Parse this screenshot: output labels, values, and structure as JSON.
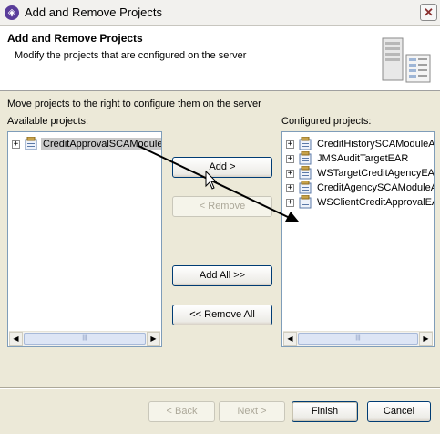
{
  "window": {
    "title": "Add and Remove Projects",
    "close_glyph": "✕",
    "app_icon": "eclipse-icon"
  },
  "banner": {
    "title": "Add and Remove Projects",
    "subtitle": "Modify the projects that are configured on the server",
    "graphic": "server-icon"
  },
  "instruction": "Move projects to the right to configure them on the server",
  "available": {
    "label": "Available projects:",
    "items": [
      {
        "label": "CreditApprovalSCAModule",
        "selected": true,
        "icon": "project-icon"
      }
    ]
  },
  "configured": {
    "label": "Configured projects:",
    "items": [
      {
        "label": "CreditHistorySCAModuleAp",
        "icon": "project-icon"
      },
      {
        "label": "JMSAuditTargetEAR",
        "icon": "project-icon"
      },
      {
        "label": "WSTargetCreditAgencyEAR",
        "icon": "project-icon"
      },
      {
        "label": "CreditAgencySCAModuleAp",
        "icon": "project-icon"
      },
      {
        "label": "WSClientCreditApprovalEA",
        "icon": "project-icon"
      }
    ]
  },
  "buttons": {
    "add": "Add >",
    "remove": "< Remove",
    "add_all": "Add All >>",
    "remove_all": "<< Remove All",
    "back": "< Back",
    "next": "Next >",
    "finish": "Finish",
    "cancel": "Cancel"
  },
  "colors": {
    "selection": "#c9c9c9",
    "dialog_bg": "#ece9d8",
    "list_border": "#7f9db9",
    "drag_arrow": "#000000"
  }
}
